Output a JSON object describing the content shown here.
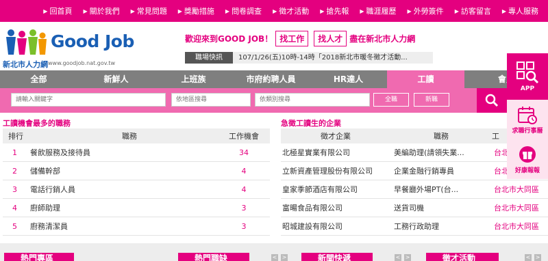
{
  "topnav": [
    {
      "label": "回首頁"
    },
    {
      "label": "關於我們"
    },
    {
      "label": "常見問題"
    },
    {
      "label": "獎勵措施"
    },
    {
      "label": "問卷調查"
    },
    {
      "label": "徵才活動"
    },
    {
      "label": "搶先報"
    },
    {
      "label": "職涯履歷"
    },
    {
      "label": "外勞簽件"
    },
    {
      "label": "訪客留言"
    },
    {
      "label": "專人服務"
    }
  ],
  "logo": {
    "word": "Good Job",
    "name": "新北市人力網",
    "url": "www.goodjob.nat.gov.tw"
  },
  "welcome": {
    "prefix": "歡迎來到GOOD JOB！",
    "find_job": "找工作",
    "find_talent": "找人才",
    "suffix": "盡在新北市人力網"
  },
  "ticker": {
    "label": "職場快訊",
    "text": "107/1/26(五)10時-14時「2018新北市暖冬徵才活動..."
  },
  "categories": [
    {
      "label": "全部"
    },
    {
      "label": "新鮮人"
    },
    {
      "label": "上班族"
    },
    {
      "label": "市府約聘人員"
    },
    {
      "label": "HR達人"
    },
    {
      "label": "工讀"
    },
    {
      "label": "會員"
    }
  ],
  "search": {
    "keyword_placeholder": "請輸入關鍵字",
    "area_placeholder": "依地區搜尋",
    "type_placeholder": "依類別搜尋",
    "btn_all": "全職",
    "btn_new": "新職"
  },
  "left_table": {
    "title": "工讀機會最多的職務",
    "headers": {
      "rank": "排行",
      "job": "職務",
      "count": "工作機會"
    },
    "rows": [
      {
        "rank": "1",
        "job": "餐飲服務及接待員",
        "count": "34"
      },
      {
        "rank": "2",
        "job": "儲備幹部",
        "count": "4"
      },
      {
        "rank": "3",
        "job": "電話行銷人員",
        "count": "4"
      },
      {
        "rank": "4",
        "job": "廚師助理",
        "count": "3"
      },
      {
        "rank": "5",
        "job": "廚務清潔員",
        "count": "3"
      }
    ]
  },
  "right_table": {
    "title": "急徵工讀生的企業",
    "headers": {
      "company": "徵才企業",
      "job": "職務",
      "loc": "工"
    },
    "rows": [
      {
        "company": "北極星實業有限公司",
        "job": "美編助理(請領失業...",
        "loc": "台北"
      },
      {
        "company": "立新資產管理股份有限公司",
        "job": "企業金融行銷專員",
        "loc": "台北市中山區"
      },
      {
        "company": "皇家季節酒店有限公司",
        "job": "早餐廳外場PT(台...",
        "loc": "台北市大同區"
      },
      {
        "company": "富暘食品有限公司",
        "job": "送貨司機",
        "loc": "台北市大同區"
      },
      {
        "company": "昭城建設有限公司",
        "job": "工務行政助理",
        "loc": "台北市大同區"
      }
    ]
  },
  "side": {
    "app": "APP",
    "calendar": "求職行事曆",
    "gift": "好康報報"
  },
  "bottom": {
    "t1": "熱門專區",
    "t2": "熱門職缺",
    "t3": "新聞快遞",
    "t4": "徵才活動",
    "prev": "<",
    "next": ">"
  },
  "colors": {
    "brand": "#e4007f",
    "light": "#f06ab0",
    "grey": "#7f7f7f"
  }
}
